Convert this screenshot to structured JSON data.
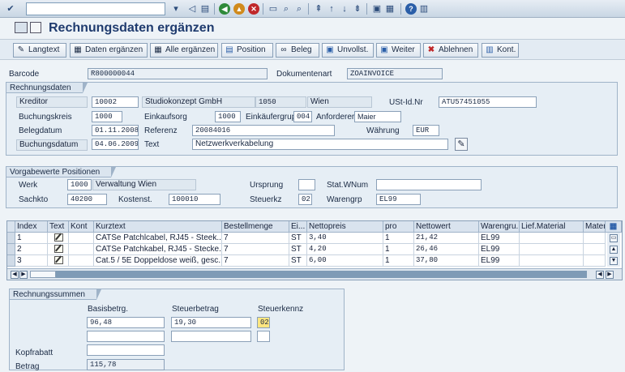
{
  "title": "Rechnungsdaten ergänzen",
  "toolbar": {
    "langtext": "Langtext",
    "daten": "Daten ergänzen",
    "alle": "Alle ergänzen",
    "position": "Position",
    "beleg": "Beleg",
    "unvollst": "Unvollst.",
    "weiter": "Weiter",
    "ablehnen": "Ablehnen",
    "kont": "Kont."
  },
  "header": {
    "barcode_label": "Barcode",
    "barcode": "R800000044",
    "dokumentenart_label": "Dokumentenart",
    "dokumentenart": "ZOAINVOICE"
  },
  "rechnungsdaten": {
    "group_title": "Rechnungsdaten",
    "kreditor_label": "Kreditor",
    "kreditor": "10002",
    "kreditor_name": "Studiokonzept GmbH",
    "plz": "1050",
    "ort": "Wien",
    "ustid_label": "USt-Id.Nr",
    "ustid": "ATU57451055",
    "buchungskreis_label": "Buchungskreis",
    "buchungskreis": "1000",
    "einkaufsorg_label": "Einkaufsorg",
    "einkaufsorg": "1000",
    "einkaeufergruppe_label": "Einkäufergruppe",
    "einkaeufergruppe": "004",
    "anforderer_label": "Anforderer",
    "anforderer": "Maier",
    "belegdatum_label": "Belegdatum",
    "belegdatum": "01.11.2008",
    "referenz_label": "Referenz",
    "referenz": "20084016",
    "waehrung_label": "Währung",
    "waehrung": "EUR",
    "buchungsdatum_label": "Buchungsdatum",
    "buchungsdatum": "04.06.2009",
    "text_label": "Text",
    "text": "Netzwerkverkabelung"
  },
  "vorgabewerte": {
    "group_title": "Vorgabewerte Positionen",
    "werk_label": "Werk",
    "werk": "1000",
    "werk_name": "Verwaltung Wien",
    "ursprung_label": "Ursprung",
    "ursprung": "",
    "statwnum_label": "Stat.WNum",
    "statwnum": "",
    "sachkto_label": "Sachkto",
    "sachkto": "40200",
    "kostenst_label": "Kostenst.",
    "kostenst": "100010",
    "steuerkz_label": "Steuerkz",
    "steuerkz": "02",
    "warengrp_label": "Warengrp",
    "warengrp": "EL99"
  },
  "table": {
    "columns": [
      "Index",
      "Text",
      "Kont",
      "Kurztext",
      "Bestellmenge",
      "Ei...",
      "Nettopreis",
      "pro",
      "Nettowert",
      "Warengru...",
      "Lief.Material",
      "Mater"
    ],
    "rows": [
      {
        "index": "1",
        "kurztext": "CATSe Patchlcabel, RJ45 - Steek...",
        "menge": "7",
        "einheit": "ST",
        "preis": "3,40",
        "pro": "1",
        "wert": "21,42",
        "wg": "EL99"
      },
      {
        "index": "2",
        "kurztext": "CATSe Patchkabel, RJ45 - Stecke...",
        "menge": "7",
        "einheit": "ST",
        "preis": "4,20",
        "pro": "1",
        "wert": "26,46",
        "wg": "EL99"
      },
      {
        "index": "3",
        "kurztext": "Cat.5 / 5E Doppeldose weiß, gesc...",
        "menge": "7",
        "einheit": "ST",
        "preis": "6,00",
        "pro": "1",
        "wert": "37,80",
        "wg": "EL99"
      }
    ]
  },
  "summen": {
    "group_title": "Rechnungssummen",
    "basis_label": "Basisbetrg.",
    "steuerbetrag_label": "Steuerbetrag",
    "steuerkennz_label": "Steuerkennz",
    "basis": "96,48",
    "steuerbetrag": "19,30",
    "steuerkennz": "02",
    "kopfrabatt_label": "Kopfrabatt",
    "kopfrabatt": "",
    "betrag_label": "Betrag",
    "betrag": "115,78"
  },
  "colors": {
    "title": "#1f3b6e",
    "background": "#eef3f7",
    "highlight_field": "#ffe680"
  }
}
